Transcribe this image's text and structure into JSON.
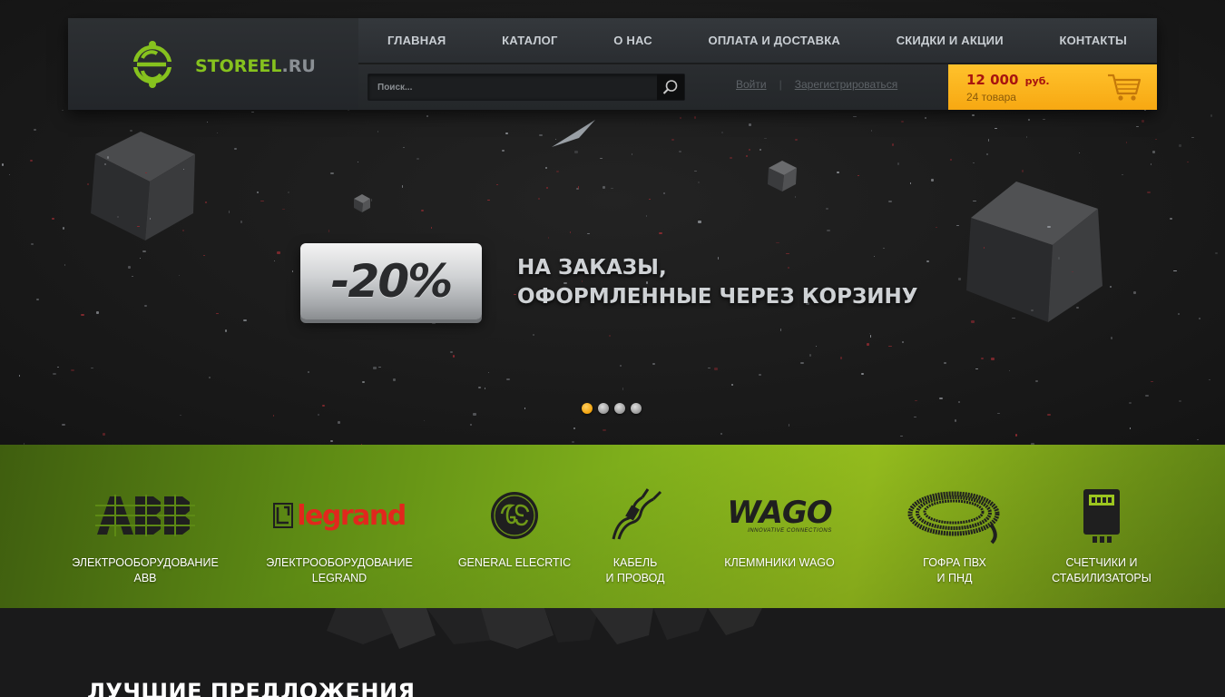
{
  "header": {
    "logo": {
      "prefix": "STOREEL",
      "suffix": ".RU"
    },
    "nav": [
      {
        "label": "ГЛАВНАЯ"
      },
      {
        "label": "КАТАЛОГ"
      },
      {
        "label": "О НАС"
      },
      {
        "label": "ОПЛАТА И ДОСТАВКА"
      },
      {
        "label": "СКИДКИ И АКЦИИ"
      },
      {
        "label": "КОНТАКТЫ"
      }
    ],
    "search": {
      "placeholder": "Поиск..."
    },
    "auth": {
      "login": "Войти",
      "separator": "|",
      "register": "Зарегистрироваться"
    },
    "cart": {
      "amount": "12 000",
      "currency": "руб.",
      "count": "24 товара"
    }
  },
  "banner": {
    "badge": "-20%",
    "line1": "НА ЗАКАЗЫ,",
    "line2": "ОФОРМЛЕННЫЕ ЧЕРЕЗ КОРЗИНУ",
    "slides_total": 4,
    "active_slide": 1
  },
  "brands": [
    {
      "icon": "abb-logo",
      "line1": "ЭЛЕКТРООБОРУДОВАНИЕ",
      "line2": "ABB"
    },
    {
      "icon": "legrand-logo",
      "line1": "ЭЛЕКТРООБОРУДОВАНИЕ",
      "line2": "LEGRAND",
      "logo_text": "legrand"
    },
    {
      "icon": "ge-logo",
      "line1": "GENERAL ELECRTIC",
      "line2": ""
    },
    {
      "icon": "cable-icon",
      "line1": "КАБЕЛЬ",
      "line2": "И ПРОВОД"
    },
    {
      "icon": "wago-logo",
      "line1": "КЛЕММНИКИ WAGO",
      "line2": "",
      "logo_text": "WAGO",
      "logo_sub": "INNOVATIVE CONNECTIONS"
    },
    {
      "icon": "corrugated-pipe-icon",
      "line1": "ГОФРА ПВХ",
      "line2": "И ПНД"
    },
    {
      "icon": "meter-icon",
      "line1": "СЧЕТЧИКИ И",
      "line2": "СТАБИЛИЗАТОРЫ"
    }
  ],
  "section": {
    "title": "ЛУЧШИЕ ПРЕДЛОЖЕНИЯ"
  },
  "colors": {
    "accent_green": "#86c21e",
    "cart_yellow": "#f7a812",
    "cart_price": "#a8140f",
    "dot_active": "#f2a20c"
  }
}
